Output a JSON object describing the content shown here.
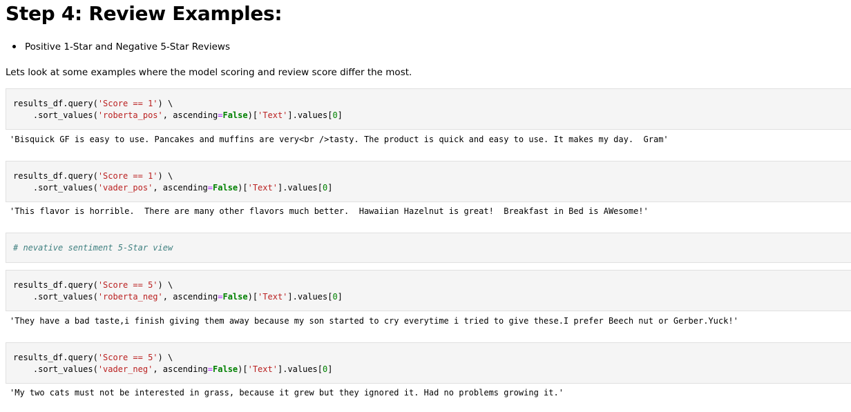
{
  "heading": "Step 4: Review Examples:",
  "bullets": [
    "Positive 1-Star and Negative 5-Star Reviews"
  ],
  "paragraph": "Lets look at some examples where the model scoring and review score differ the most.",
  "cells": [
    {
      "line1": [
        "results_df.query(",
        "'Score == 1'",
        ") \\"
      ],
      "line2": [
        "    .sort_values(",
        "'roberta_pos'",
        ", ascending",
        "=",
        "False",
        ")[",
        "'Text'",
        "].values[",
        "0",
        "]"
      ],
      "output": "'Bisquick GF is easy to use. Pancakes and muffins are very<br />tasty. The product is quick and easy to use. It makes my day.  Gram'"
    },
    {
      "line1": [
        "results_df.query(",
        "'Score == 1'",
        ") \\"
      ],
      "line2": [
        "    .sort_values(",
        "'vader_pos'",
        ", ascending",
        "=",
        "False",
        ")[",
        "'Text'",
        "].values[",
        "0",
        "]"
      ],
      "output": "'This flavor is horrible.  There are many other flavors much better.  Hawaiian Hazelnut is great!  Breakfast in Bed is AWesome!'"
    },
    {
      "line1": [
        "results_df.query(",
        "'Score == 5'",
        ") \\"
      ],
      "line2": [
        "    .sort_values(",
        "'roberta_neg'",
        ", ascending",
        "=",
        "False",
        ")[",
        "'Text'",
        "].values[",
        "0",
        "]"
      ],
      "output": "'They have a bad taste,i finish giving them away because my son started to cry everytime i tried to give these.I prefer Beech nut or Gerber.Yuck!'"
    },
    {
      "line1": [
        "results_df.query(",
        "'Score == 5'",
        ") \\"
      ],
      "line2": [
        "    .sort_values(",
        "'vader_neg'",
        ", ascending",
        "=",
        "False",
        ")[",
        "'Text'",
        "].values[",
        "0",
        "]"
      ],
      "output": "'My two cats must not be interested in grass, because it grew but they ignored it. Had no problems growing it.'"
    }
  ],
  "comment_cell": "# nevative sentiment 5-Star view"
}
